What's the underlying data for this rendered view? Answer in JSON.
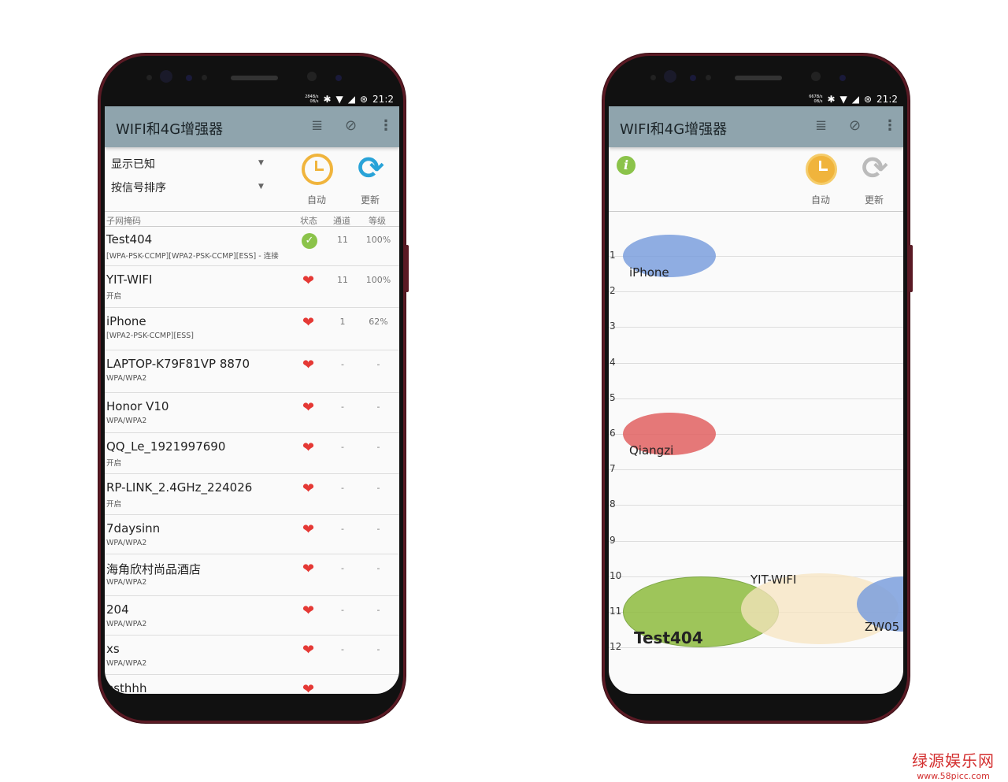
{
  "left": {
    "status": {
      "speed_up": "284B/s",
      "speed_down": "0B/s",
      "time": "21:2"
    },
    "appbar": {
      "title": "WIFI和4G增强器"
    },
    "filters": {
      "show": "显示已知",
      "sort": "按信号排序"
    },
    "buttons": {
      "auto": "自动",
      "refresh": "更新"
    },
    "columns": {
      "ssid": "子网掩码",
      "status": "状态",
      "channel": "通道",
      "level": "等级"
    },
    "networks": [
      {
        "ssid": "Test404",
        "caps": "[WPA-PSK-CCMP][WPA2-PSK-CCMP][ESS] - 连接",
        "status": "connected",
        "channel": "11",
        "level": "100%"
      },
      {
        "ssid": "YIT-WIFI",
        "caps": "开启",
        "status": "heart",
        "channel": "11",
        "level": "100%"
      },
      {
        "ssid": "iPhone",
        "caps": "[WPA2-PSK-CCMP][ESS]",
        "status": "heart",
        "channel": "1",
        "level": "62%"
      },
      {
        "ssid": "LAPTOP-K79F81VP 8870",
        "caps": "WPA/WPA2",
        "status": "heart",
        "channel": "-",
        "level": "-"
      },
      {
        "ssid": "Honor V10",
        "caps": "WPA/WPA2",
        "status": "heart",
        "channel": "-",
        "level": "-"
      },
      {
        "ssid": "QQ_Le_1921997690",
        "caps": "开启",
        "status": "heart",
        "channel": "-",
        "level": "-"
      },
      {
        "ssid": "RP-LINK_2.4GHz_224026",
        "caps": "开启",
        "status": "heart",
        "channel": "-",
        "level": "-"
      },
      {
        "ssid": "7daysinn",
        "caps": "WPA/WPA2",
        "status": "heart",
        "channel": "-",
        "level": "-"
      },
      {
        "ssid": "海角欣村尚品酒店",
        "caps": "WPA/WPA2",
        "status": "heart",
        "channel": "-",
        "level": "-"
      },
      {
        "ssid": "204",
        "caps": "WPA/WPA2",
        "status": "heart",
        "channel": "-",
        "level": "-"
      },
      {
        "ssid": "xs",
        "caps": "WPA/WPA2",
        "status": "heart",
        "channel": "-",
        "level": "-"
      },
      {
        "ssid": "esthhh",
        "caps": "",
        "status": "heart",
        "channel": "",
        "level": ""
      }
    ]
  },
  "right": {
    "status": {
      "speed_up": "667B/s",
      "speed_down": "0B/s",
      "time": "21:2"
    },
    "appbar": {
      "title": "WIFI和4G增强器"
    },
    "buttons": {
      "auto": "自动",
      "refresh": "更新"
    },
    "channels": [
      "1",
      "2",
      "3",
      "4",
      "5",
      "6",
      "7",
      "8",
      "9",
      "10",
      "11",
      "12"
    ],
    "networks": [
      {
        "name": "iPhone",
        "channel": 1,
        "color": "#7b9fdd"
      },
      {
        "name": "Qiangzi",
        "channel": 6,
        "color": "#e06060"
      },
      {
        "name": "Test404",
        "channel": 11,
        "color": "#8fbc3f"
      },
      {
        "name": "YIT-WIFI",
        "channel": 11,
        "color": "#f7e4c0"
      },
      {
        "name": "ZW05",
        "channel": 13,
        "color": "#7b9fdd"
      }
    ]
  },
  "icons": {
    "heart": "#e53935",
    "connected": "#8bc34a",
    "auto": "#f0b43c",
    "refresh_active": "#29a3d8",
    "refresh_inactive": "#bbb",
    "info": "#8bc34a"
  },
  "watermark": {
    "name": "绿源娱乐网",
    "url": "www.58picc.com"
  }
}
